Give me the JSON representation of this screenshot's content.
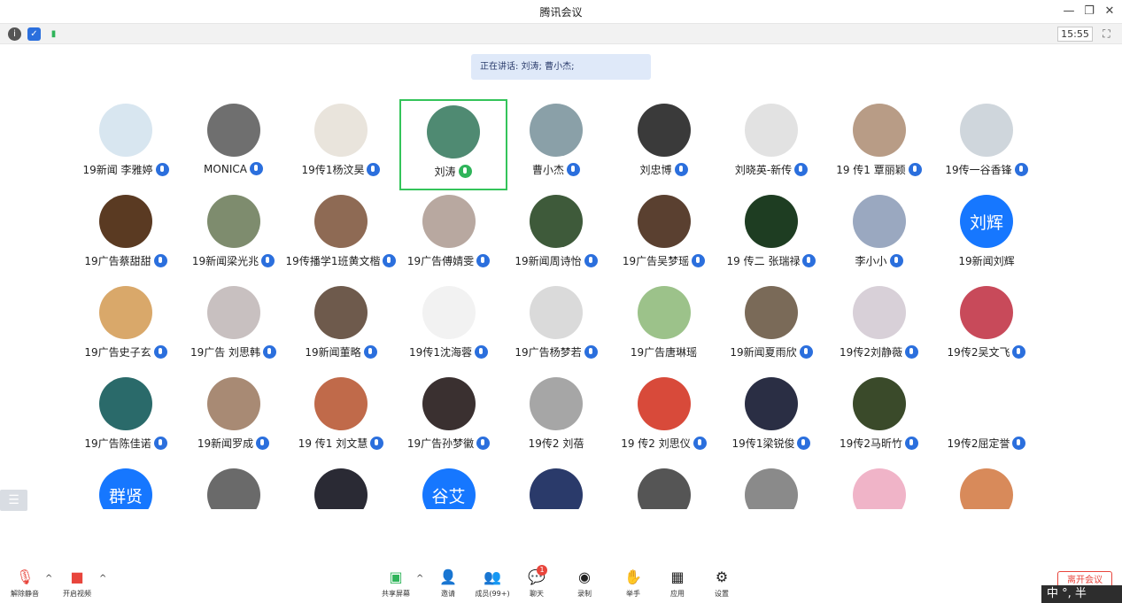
{
  "window": {
    "title": "腾讯会议"
  },
  "infobar": {
    "time": "15:55"
  },
  "speaking": "正在讲话: 刘涛; 曹小杰;",
  "participants": [
    {
      "name": "19新闻 李雅婷",
      "color": "#d8e6f0"
    },
    {
      "name": "MONICA",
      "color": "#6f6f6f"
    },
    {
      "name": "19传1杨汶昊",
      "color": "#e9e4dc"
    },
    {
      "name": "刘涛",
      "color": "#4f8a72",
      "active": true,
      "mic": "green"
    },
    {
      "name": "曹小杰",
      "color": "#8aa0a8"
    },
    {
      "name": "刘忠博",
      "color": "#3a3a3a"
    },
    {
      "name": "刘晓英-新传",
      "color": "#e2e2e2"
    },
    {
      "name": "19 传1 覃丽颖",
      "color": "#b89c86"
    },
    {
      "name": "19传一谷香锋",
      "color": "#cfd6dc"
    },
    {
      "name": "19广告蔡甜甜",
      "color": "#5a3a22"
    },
    {
      "name": "19新闻梁光兆",
      "color": "#7e8c6e"
    },
    {
      "name": "19传播学1班黄文楷",
      "color": "#8e6a54"
    },
    {
      "name": "19广告傅婧雯",
      "color": "#b8a8a0"
    },
    {
      "name": "19新闻周诗怡",
      "color": "#3e5a3a"
    },
    {
      "name": "19广告吴梦瑶",
      "color": "#5a4030"
    },
    {
      "name": "19 传二 张瑞禄",
      "color": "#1e3d22"
    },
    {
      "name": "李小小",
      "color": "#9aa8c0"
    },
    {
      "name": "19新闻刘辉",
      "color": "#1677ff",
      "text": "刘辉",
      "mic": "none"
    },
    {
      "name": "19广告史子玄",
      "color": "#d9a86a"
    },
    {
      "name": "19广告 刘思韩",
      "color": "#c8c0c0"
    },
    {
      "name": "19新闻董略",
      "color": "#6e5a4c"
    },
    {
      "name": "19传1沈海蓉",
      "color": "#f2f2f2"
    },
    {
      "name": "19广告杨梦若",
      "color": "#dadada"
    },
    {
      "name": "19广告唐琳瑶",
      "color": "#9cc28a",
      "mic": "none"
    },
    {
      "name": "19新闻夏雨欣",
      "color": "#7a6a58"
    },
    {
      "name": "19传2刘静薇",
      "color": "#d8d0d8"
    },
    {
      "name": "19传2吴文飞",
      "color": "#c84a5a"
    },
    {
      "name": "19广告陈佳诺",
      "color": "#2a6a6a"
    },
    {
      "name": "19新闻罗成",
      "color": "#a88a74"
    },
    {
      "name": "19 传1 刘文慧",
      "color": "#c06a4a"
    },
    {
      "name": "19广告孙梦徽",
      "color": "#3a3030"
    },
    {
      "name": "19传2 刘蓓",
      "color": "#a6a6a6",
      "mic": "none"
    },
    {
      "name": "19 传2 刘思仪",
      "color": "#d84a3a"
    },
    {
      "name": "19传1梁锐俊",
      "color": "#2a2e44"
    },
    {
      "name": "19传2马昕竹",
      "color": "#3a4a2a"
    },
    {
      "name": "19传2屈定誉",
      "color": "#ffffff"
    },
    {
      "name": "",
      "color": "#1677ff",
      "text": "群贤",
      "mic": "none"
    },
    {
      "name": "",
      "color": "#6a6a6a",
      "mic": "none"
    },
    {
      "name": "",
      "color": "#2a2a34",
      "mic": "none"
    },
    {
      "name": "",
      "color": "#1677ff",
      "text": "谷艾",
      "mic": "none"
    },
    {
      "name": "",
      "color": "#2a3a6a",
      "mic": "none"
    },
    {
      "name": "",
      "color": "#555555",
      "mic": "none"
    },
    {
      "name": "",
      "color": "#8a8a8a",
      "mic": "none"
    },
    {
      "name": "",
      "color": "#f0b4c8",
      "mic": "none"
    },
    {
      "name": "",
      "color": "#d88a5a",
      "mic": "none"
    }
  ],
  "toolbar": {
    "unmute": "解除静音",
    "start_video": "开启视频",
    "share": "共享屏幕",
    "invite": "邀请",
    "members": "成员(99+)",
    "chat": "聊天",
    "chat_badge": "1",
    "record": "录制",
    "raise_hand": "举手",
    "apps": "应用",
    "settings": "设置",
    "leave": "离开会议"
  },
  "ime": {
    "text": "中 °, 半"
  }
}
